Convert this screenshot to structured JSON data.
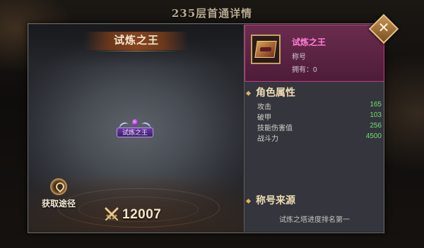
{
  "header": {
    "title": "235层首通详情"
  },
  "preview": {
    "title": "试炼之王",
    "badge_text": "试炼之王",
    "source_button_label": "获取途径",
    "power_value": "12007"
  },
  "item": {
    "name": "试炼之王",
    "type": "称号",
    "owned": "拥有：0"
  },
  "attributes": {
    "heading": "角色属性",
    "rows": [
      {
        "name": "攻击",
        "value": "165"
      },
      {
        "name": "破甲",
        "value": "103"
      },
      {
        "name": "技能伤害值",
        "value": "256"
      },
      {
        "name": "战斗力",
        "value": "4500"
      }
    ]
  },
  "origin": {
    "heading": "称号来源",
    "text": "试炼之塔进度排名第一"
  },
  "colors": {
    "rarity": "#ff7fd8",
    "attr_value": "#6fe06a",
    "accent": "#e0b45c"
  },
  "icons": {
    "close": "close-icon",
    "source": "map-pin-icon",
    "power": "crossed-swords-icon"
  }
}
